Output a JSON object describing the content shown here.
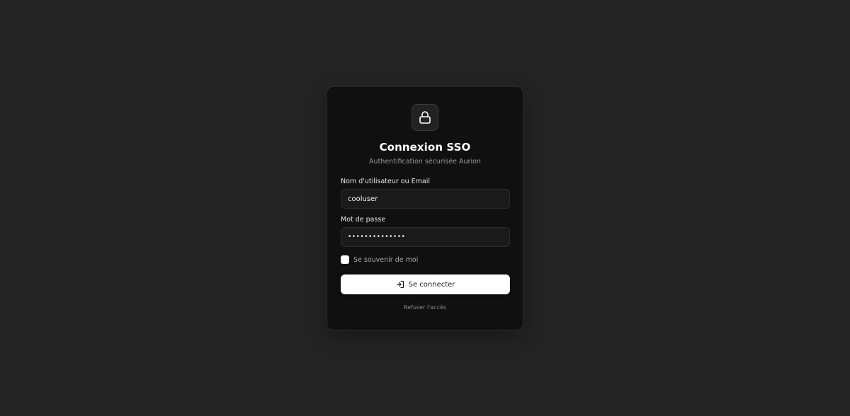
{
  "login": {
    "title": "Connexion SSO",
    "subtitle": "Authentification sécurisée Aurion",
    "username_label": "Nom d'utilisateur ou Email",
    "username_value": "cooluser",
    "password_label": "Mot de passe",
    "password_value": "••••••••••••••",
    "remember_label": "Se souvenir de moi",
    "remember_checked": false,
    "submit_label": "Se connecter",
    "refuse_label": "Refuser l'accès"
  },
  "icons": {
    "header": "lock-icon",
    "submit": "sign-in-icon"
  },
  "colors": {
    "background": "#242424",
    "card": "#101010",
    "button": "#ffffff"
  }
}
